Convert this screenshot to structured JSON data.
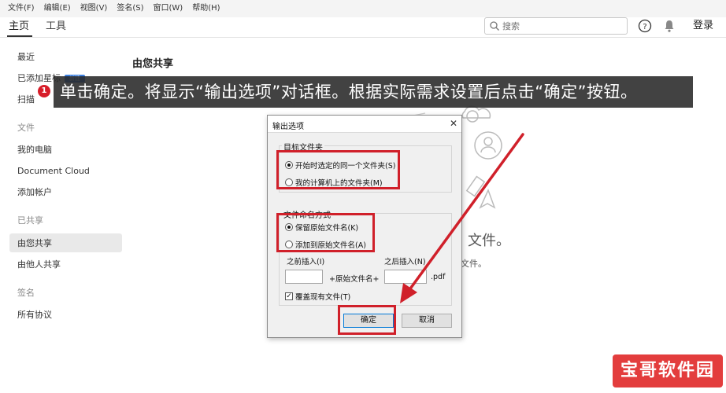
{
  "menu": [
    "文件(F)",
    "编辑(E)",
    "视图(V)",
    "签名(S)",
    "窗口(W)",
    "帮助(H)"
  ],
  "toolbar": {
    "tabs": [
      "主页",
      "工具"
    ],
    "search_placeholder": "搜索",
    "login": "登录"
  },
  "sidebar": {
    "recent": "最近",
    "starred": "已添加星标",
    "new_badge": "新建",
    "scan": "扫描",
    "files_header": "文件",
    "my_computer": "我的电脑",
    "document_cloud": "Document Cloud",
    "add_account": "添加帐户",
    "shared_header": "已共享",
    "shared_by_you": "由您共享",
    "shared_by_others": "由他人共享",
    "sign_header": "签名",
    "all_agreements": "所有协议",
    "notification_count": "1"
  },
  "main": {
    "title": "由您共享",
    "bg_text_large": "文件。",
    "bg_text_small": "文件。"
  },
  "banner": {
    "text": "单击确定。将显示“输出选项”对话框。根据实际需求设置后点击“确定”按钮。"
  },
  "dialog": {
    "title": "输出选项",
    "target_folder_label": "目标文件夹",
    "target_option_same": "开始时选定的同一个文件夹(S)",
    "target_option_mine": "我的计算机上的文件夹(M)",
    "naming_label": "文件命名方式",
    "naming_keep": "保留原始文件名(K)",
    "naming_add": "添加到原始文件名(A)",
    "insert_before": "之前插入(I)",
    "insert_after": "之后插入(N)",
    "original_name": "+原始文件名+",
    "ext": ".pdf",
    "overwrite": "覆盖现有文件(T)",
    "ok": "确定",
    "cancel": "取消",
    "target_selected": "same",
    "naming_selected": "keep",
    "overwrite_checked": true
  },
  "colors": {
    "highlight": "#d0202a",
    "banner_bg": "#282828",
    "watermark": "#e12d2d"
  },
  "watermark": "宝哥软件园"
}
